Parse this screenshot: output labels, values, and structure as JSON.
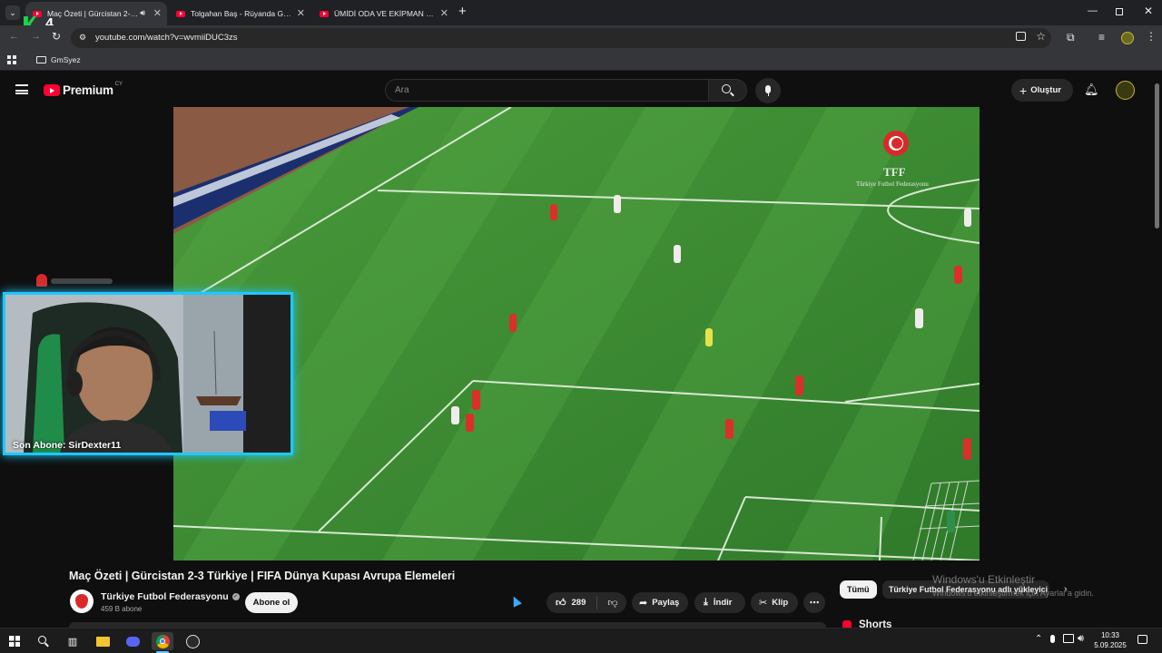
{
  "browser": {
    "tabs": [
      {
        "title": "Maç Özeti | Gürcistan 2-3 Tü",
        "active": true
      },
      {
        "title": "Tolgahan Baş - Rüyanda Görsen",
        "active": false
      },
      {
        "title": "ÜMİDİ ODA VE EKİPMAN VLOG",
        "active": false
      }
    ],
    "url": "youtube.com/watch?v=wvmiiDUC3zs",
    "bookmark_folder": "GmSyez"
  },
  "overlay": {
    "logo_text": "4",
    "webcam_caption": "Son Abone: SirDexter11"
  },
  "youtube": {
    "logo_text": "Premium",
    "region_badge": "CY",
    "search_placeholder": "Ara",
    "create_label": "Oluştur",
    "video": {
      "title": "Maç Özeti | Gürcistan 2-3 Türkiye | FIFA Dünya Kupası Avrupa Elemeleri",
      "watermark_title": "TFF",
      "watermark_sub": "Türkiye Futbol Federasyonu"
    },
    "channel": {
      "name": "Türkiye Futbol Federasyonu",
      "subscribers": "459 B abone",
      "subscribe_label": "Abone ol"
    },
    "actions": {
      "likes": "289",
      "share": "Paylaş",
      "download": "İndir",
      "clip": "Klip"
    },
    "chips": {
      "all": "Tümü",
      "uploader": "Türkiye Futbol Federasyonu adlı yükleyici"
    },
    "shorts_label": "Shorts"
  },
  "windows": {
    "activation_title": "Windows'u Etkinleştir",
    "activation_sub": "Windows'u etkinleştirmek için Ayarlar'a gidin.",
    "clock_time": "10:33",
    "clock_date": "5.09.2025"
  },
  "colors": {
    "webcam_border": "#1ec8ff",
    "brand": "#ff0033",
    "pitch": "#3f8f35"
  }
}
